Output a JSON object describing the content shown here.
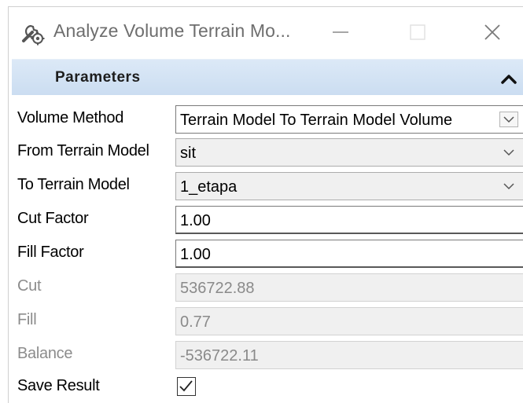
{
  "window": {
    "title": "Analyze Volume Terrain Mo..."
  },
  "section": {
    "title": "Parameters"
  },
  "fields": {
    "volume_method": {
      "label": "Volume Method",
      "value": "Terrain Model To Terrain Model Volume"
    },
    "from_terrain": {
      "label": "From Terrain Model",
      "value": "sit"
    },
    "to_terrain": {
      "label": "To Terrain Model",
      "value": "1_etapa"
    },
    "cut_factor": {
      "label": "Cut Factor",
      "value": "1.00"
    },
    "fill_factor": {
      "label": "Fill Factor",
      "value": "1.00"
    },
    "cut": {
      "label": "Cut",
      "value": "536722.88"
    },
    "fill": {
      "label": "Fill",
      "value": "0.77"
    },
    "balance": {
      "label": "Balance",
      "value": "-536722.11"
    },
    "save_result": {
      "label": "Save Result",
      "checked": true
    }
  },
  "colors": {
    "header_bg": "#cfe0f3",
    "readonly_bg": "#f0f0f0",
    "disabled_text": "#8c8c8c"
  },
  "icons": {
    "app": "wrench-gear-icon",
    "minimize": "minimize-icon",
    "maximize": "maximize-icon",
    "close": "close-icon",
    "collapse": "chevron-up-icon",
    "dropdown": "chevron-down-icon",
    "check": "checkmark-icon"
  }
}
